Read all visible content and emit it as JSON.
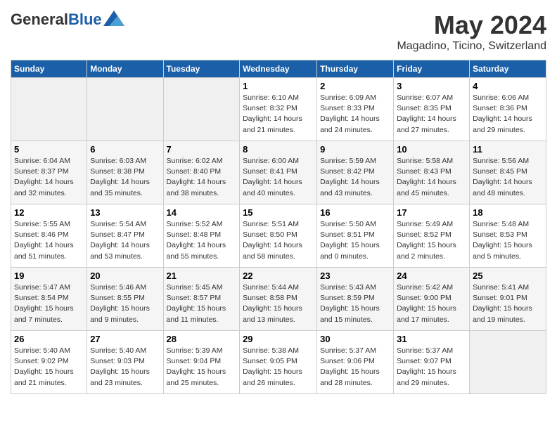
{
  "header": {
    "logo_general": "General",
    "logo_blue": "Blue",
    "month": "May 2024",
    "location": "Magadino, Ticino, Switzerland"
  },
  "days_of_week": [
    "Sunday",
    "Monday",
    "Tuesday",
    "Wednesday",
    "Thursday",
    "Friday",
    "Saturday"
  ],
  "weeks": [
    [
      {
        "day": "",
        "info": ""
      },
      {
        "day": "",
        "info": ""
      },
      {
        "day": "",
        "info": ""
      },
      {
        "day": "1",
        "info": "Sunrise: 6:10 AM\nSunset: 8:32 PM\nDaylight: 14 hours\nand 21 minutes."
      },
      {
        "day": "2",
        "info": "Sunrise: 6:09 AM\nSunset: 8:33 PM\nDaylight: 14 hours\nand 24 minutes."
      },
      {
        "day": "3",
        "info": "Sunrise: 6:07 AM\nSunset: 8:35 PM\nDaylight: 14 hours\nand 27 minutes."
      },
      {
        "day": "4",
        "info": "Sunrise: 6:06 AM\nSunset: 8:36 PM\nDaylight: 14 hours\nand 29 minutes."
      }
    ],
    [
      {
        "day": "5",
        "info": "Sunrise: 6:04 AM\nSunset: 8:37 PM\nDaylight: 14 hours\nand 32 minutes."
      },
      {
        "day": "6",
        "info": "Sunrise: 6:03 AM\nSunset: 8:38 PM\nDaylight: 14 hours\nand 35 minutes."
      },
      {
        "day": "7",
        "info": "Sunrise: 6:02 AM\nSunset: 8:40 PM\nDaylight: 14 hours\nand 38 minutes."
      },
      {
        "day": "8",
        "info": "Sunrise: 6:00 AM\nSunset: 8:41 PM\nDaylight: 14 hours\nand 40 minutes."
      },
      {
        "day": "9",
        "info": "Sunrise: 5:59 AM\nSunset: 8:42 PM\nDaylight: 14 hours\nand 43 minutes."
      },
      {
        "day": "10",
        "info": "Sunrise: 5:58 AM\nSunset: 8:43 PM\nDaylight: 14 hours\nand 45 minutes."
      },
      {
        "day": "11",
        "info": "Sunrise: 5:56 AM\nSunset: 8:45 PM\nDaylight: 14 hours\nand 48 minutes."
      }
    ],
    [
      {
        "day": "12",
        "info": "Sunrise: 5:55 AM\nSunset: 8:46 PM\nDaylight: 14 hours\nand 51 minutes."
      },
      {
        "day": "13",
        "info": "Sunrise: 5:54 AM\nSunset: 8:47 PM\nDaylight: 14 hours\nand 53 minutes."
      },
      {
        "day": "14",
        "info": "Sunrise: 5:52 AM\nSunset: 8:48 PM\nDaylight: 14 hours\nand 55 minutes."
      },
      {
        "day": "15",
        "info": "Sunrise: 5:51 AM\nSunset: 8:50 PM\nDaylight: 14 hours\nand 58 minutes."
      },
      {
        "day": "16",
        "info": "Sunrise: 5:50 AM\nSunset: 8:51 PM\nDaylight: 15 hours\nand 0 minutes."
      },
      {
        "day": "17",
        "info": "Sunrise: 5:49 AM\nSunset: 8:52 PM\nDaylight: 15 hours\nand 2 minutes."
      },
      {
        "day": "18",
        "info": "Sunrise: 5:48 AM\nSunset: 8:53 PM\nDaylight: 15 hours\nand 5 minutes."
      }
    ],
    [
      {
        "day": "19",
        "info": "Sunrise: 5:47 AM\nSunset: 8:54 PM\nDaylight: 15 hours\nand 7 minutes."
      },
      {
        "day": "20",
        "info": "Sunrise: 5:46 AM\nSunset: 8:55 PM\nDaylight: 15 hours\nand 9 minutes."
      },
      {
        "day": "21",
        "info": "Sunrise: 5:45 AM\nSunset: 8:57 PM\nDaylight: 15 hours\nand 11 minutes."
      },
      {
        "day": "22",
        "info": "Sunrise: 5:44 AM\nSunset: 8:58 PM\nDaylight: 15 hours\nand 13 minutes."
      },
      {
        "day": "23",
        "info": "Sunrise: 5:43 AM\nSunset: 8:59 PM\nDaylight: 15 hours\nand 15 minutes."
      },
      {
        "day": "24",
        "info": "Sunrise: 5:42 AM\nSunset: 9:00 PM\nDaylight: 15 hours\nand 17 minutes."
      },
      {
        "day": "25",
        "info": "Sunrise: 5:41 AM\nSunset: 9:01 PM\nDaylight: 15 hours\nand 19 minutes."
      }
    ],
    [
      {
        "day": "26",
        "info": "Sunrise: 5:40 AM\nSunset: 9:02 PM\nDaylight: 15 hours\nand 21 minutes."
      },
      {
        "day": "27",
        "info": "Sunrise: 5:40 AM\nSunset: 9:03 PM\nDaylight: 15 hours\nand 23 minutes."
      },
      {
        "day": "28",
        "info": "Sunrise: 5:39 AM\nSunset: 9:04 PM\nDaylight: 15 hours\nand 25 minutes."
      },
      {
        "day": "29",
        "info": "Sunrise: 5:38 AM\nSunset: 9:05 PM\nDaylight: 15 hours\nand 26 minutes."
      },
      {
        "day": "30",
        "info": "Sunrise: 5:37 AM\nSunset: 9:06 PM\nDaylight: 15 hours\nand 28 minutes."
      },
      {
        "day": "31",
        "info": "Sunrise: 5:37 AM\nSunset: 9:07 PM\nDaylight: 15 hours\nand 29 minutes."
      },
      {
        "day": "",
        "info": ""
      }
    ]
  ]
}
